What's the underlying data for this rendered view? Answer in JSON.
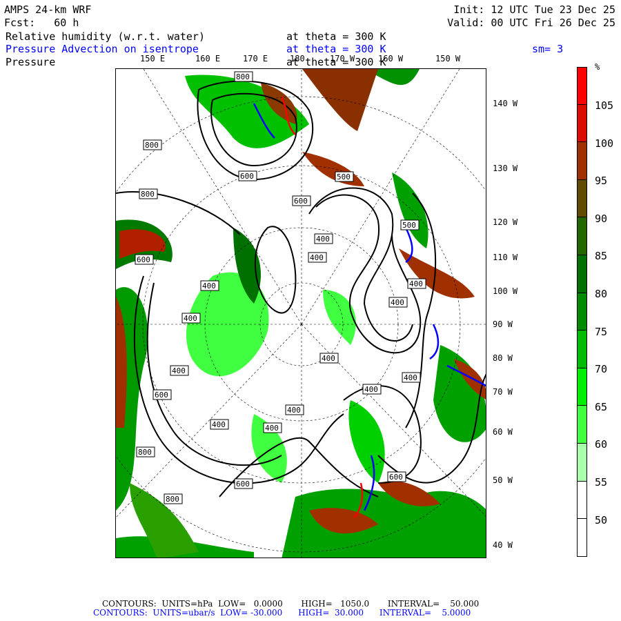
{
  "header": {
    "model": "AMPS 24-km WRF",
    "fcst": "Fcst:   60 h",
    "init": "Init: 12 UTC Tue 23 Dec 25",
    "valid": "Valid: 00 UTC Fri 26 Dec 25",
    "field1": "Relative humidity (w.r.t. water)",
    "field1_level": "at theta = 300 K",
    "field2": "Pressure Advection on isentrope",
    "field2_level": "at theta = 300 K",
    "field2_smooth": "sm= 3",
    "field3": "Pressure",
    "field3_level": "at theta = 300 K"
  },
  "lon_labels": [
    "150 E",
    "160 E",
    "170 E",
    "180",
    "170 W",
    "160 W",
    "150 W"
  ],
  "lat_labels": [
    "140 W",
    "130 W",
    "120 W",
    "110 W",
    "100 W",
    "90 W",
    "80 W",
    "70 W",
    "60 W",
    "50 W",
    "40 W"
  ],
  "colorbar": {
    "unit": "%",
    "labels": [
      "105",
      "100",
      "95",
      "90",
      "85",
      "80",
      "75",
      "70",
      "65",
      "60",
      "55",
      "50"
    ],
    "colors": [
      "#ff0000",
      "#dd0c00",
      "#a03000",
      "#604c00",
      "#236600",
      "#007000",
      "#008a00",
      "#00bb00",
      "#00ee00",
      "#40ff40",
      "#aaffaa",
      "#ffffff",
      "#ffffff"
    ]
  },
  "contour_labels": [
    "800",
    "800",
    "800",
    "600",
    "500",
    "600",
    "500",
    "400",
    "400",
    "600",
    "400",
    "400",
    "400",
    "400",
    "400",
    "400",
    "600",
    "400",
    "400",
    "400",
    "400",
    "400",
    "800",
    "600",
    "800",
    "600"
  ],
  "footer": {
    "line1": "CONTOURS:  UNITS=hPa  LOW=   0.0000       HIGH=   1050.0       INTERVAL=    50.000",
    "line2": "CONTOURS:  UNITS=ubar/s  LOW= -30.000      HIGH=  30.000      INTERVAL=    5.0000"
  }
}
